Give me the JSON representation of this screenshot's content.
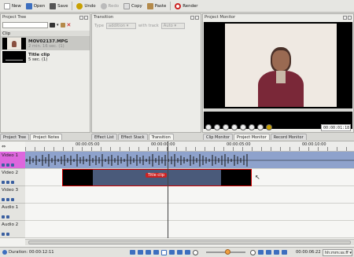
{
  "toolbar": {
    "items": [
      {
        "label": "New",
        "icon": "new-document-icon",
        "color": "#ffffff"
      },
      {
        "label": "Open",
        "icon": "folder-open-icon",
        "color": "#3d6fbf"
      },
      {
        "label": "Save",
        "icon": "save-disk-icon",
        "color": "#555555"
      },
      {
        "label": "Undo",
        "icon": "undo-icon",
        "color": "#c8a000"
      },
      {
        "label": "Redo",
        "icon": "redo-icon",
        "color": "#bbbbbb"
      },
      {
        "label": "Copy",
        "icon": "copy-icon",
        "color": "#cccccc"
      },
      {
        "label": "Paste",
        "icon": "paste-icon",
        "color": "#b48a4a"
      },
      {
        "label": "Render",
        "icon": "render-icon",
        "color": "#cc2222"
      }
    ]
  },
  "project_tree": {
    "title": "Project Tree",
    "section": "Clip",
    "clips": [
      {
        "name": "MOV02137.MPG",
        "meta": "2 min. 16 sec. (1)"
      },
      {
        "name": "Title clip",
        "meta": "5 sec. (1)"
      }
    ]
  },
  "transition": {
    "title": "Transition",
    "type_label": "Type",
    "type_value": "addition",
    "track_label": "with track",
    "track_value": "Auto"
  },
  "project_monitor": {
    "title": "Project Monitor",
    "timecode": "00:00:01:18"
  },
  "left_tabs": [
    "Project Tree",
    "Project Notes"
  ],
  "mid_tabs": [
    "Effect List",
    "Effect Stack",
    "Transition"
  ],
  "monitor_tabs": [
    "Clip Monitor",
    "Project Monitor",
    "Record Monitor"
  ],
  "ruler": {
    "ticks": [
      "00:00:05:00",
      "00:00:00:00",
      "00:00:05:00",
      "00:00:10:00"
    ]
  },
  "tracks": [
    {
      "name": "Video 1"
    },
    {
      "name": "Video 2"
    },
    {
      "name": "Video 3"
    },
    {
      "name": "Audio 1"
    },
    {
      "name": "Audio 2"
    }
  ],
  "title_clip_label": "Title clip",
  "status": {
    "duration": "Duration: 00:00:12:11",
    "timecode": "00:00:06:22",
    "mode": "hh:mm:ss:ff"
  }
}
